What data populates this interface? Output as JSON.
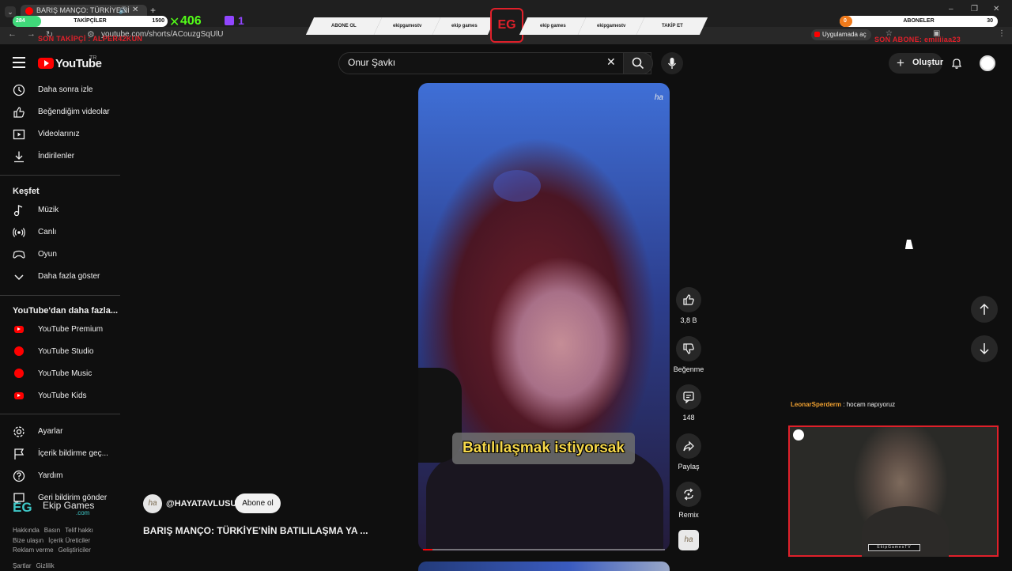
{
  "browser": {
    "tab_title": "BARIŞ MANÇO: TÜRKİYE'Nİ",
    "url": "youtube.com/shorts/ACouzgSqUlU",
    "open_in_app": "Uygulamada aç"
  },
  "overlay": {
    "followers_label": "TAKİPÇİLER",
    "followers_current": "284",
    "followers_goal": "1500",
    "kick_count": "406",
    "twitch_count": "1",
    "last_follower": "SON TAKİPÇİ : ALPER42KUN",
    "subscribers_label": "ABONELER",
    "subscribers_current": "0",
    "subscribers_goal": "30",
    "last_subscriber": "SON ABONE: emiiiiaa23",
    "ribbons": [
      "ABONE OL",
      "ekipgamestv",
      "ekip games",
      "ekip games",
      "ekipgamestv",
      "TAKİP ET"
    ],
    "logo_text": "EG",
    "brand_name": "Ekip Games",
    "brand_domain": ".com",
    "chat_user": "LeonarSperderm",
    "chat_message": ": hocam napıyoruz",
    "cam_tag": "EkipGamesTV"
  },
  "header": {
    "logo_text": "YouTube",
    "country_code": "TR",
    "search_value": "Onur Şavkı",
    "create_label": "Oluştur"
  },
  "sidebar": {
    "top_items": [
      {
        "label": "Daha sonra izle",
        "icon": "clock-icon"
      },
      {
        "label": "Beğendiğim videolar",
        "icon": "thumb-up-icon"
      },
      {
        "label": "Videolarınız",
        "icon": "play-square-icon"
      },
      {
        "label": "İndirilenler",
        "icon": "download-icon"
      }
    ],
    "explore_heading": "Keşfet",
    "explore_items": [
      {
        "label": "Müzik",
        "icon": "music-note-icon"
      },
      {
        "label": "Canlı",
        "icon": "live-icon"
      },
      {
        "label": "Oyun",
        "icon": "gamepad-icon"
      },
      {
        "label": "Daha fazla göster",
        "icon": "chevron-down-icon"
      }
    ],
    "more_heading": "YouTube'dan daha fazla...",
    "more_items": [
      {
        "label": "YouTube Premium"
      },
      {
        "label": "YouTube Studio"
      },
      {
        "label": "YouTube Music"
      },
      {
        "label": "YouTube Kids"
      }
    ],
    "settings_items": [
      {
        "label": "Ayarlar",
        "icon": "gear-icon"
      },
      {
        "label": "İçerik bildirme geç...",
        "icon": "flag-icon"
      },
      {
        "label": "Yardım",
        "icon": "help-icon"
      },
      {
        "label": "Geri bildirim gönder",
        "icon": "feedback-icon"
      }
    ],
    "footer_row1": [
      "Hakkında",
      "Basın",
      "Telif hakkı"
    ],
    "footer_row2": [
      "Bize ulaşın",
      "İçerik Üreticiler"
    ],
    "footer_row3": [
      "Reklam verme",
      "Geliştiriciler"
    ],
    "footer_row4": [
      "Şartlar",
      "Gizlilik"
    ]
  },
  "short": {
    "subtitle": "Batılılaşmak istiyorsak",
    "watermark": "ha",
    "channel_handle": "@HAYATAVLUSU",
    "channel_avatar_text": "ha",
    "subscribe_label": "Abone ol",
    "title": "BARIŞ MANÇO: TÜRKİYE'NİN BATILILAŞMA YA ...",
    "like_count": "3,8 B",
    "dislike_label": "Beğenme",
    "comment_count": "148",
    "share_label": "Paylaş",
    "remix_label": "Remix",
    "progress": 0.04
  },
  "colors": {
    "background": "#0f0f0f",
    "accent_red": "#ff0000",
    "overlay_red": "#e0202a",
    "subtitle_yellow": "#f6d84a"
  }
}
